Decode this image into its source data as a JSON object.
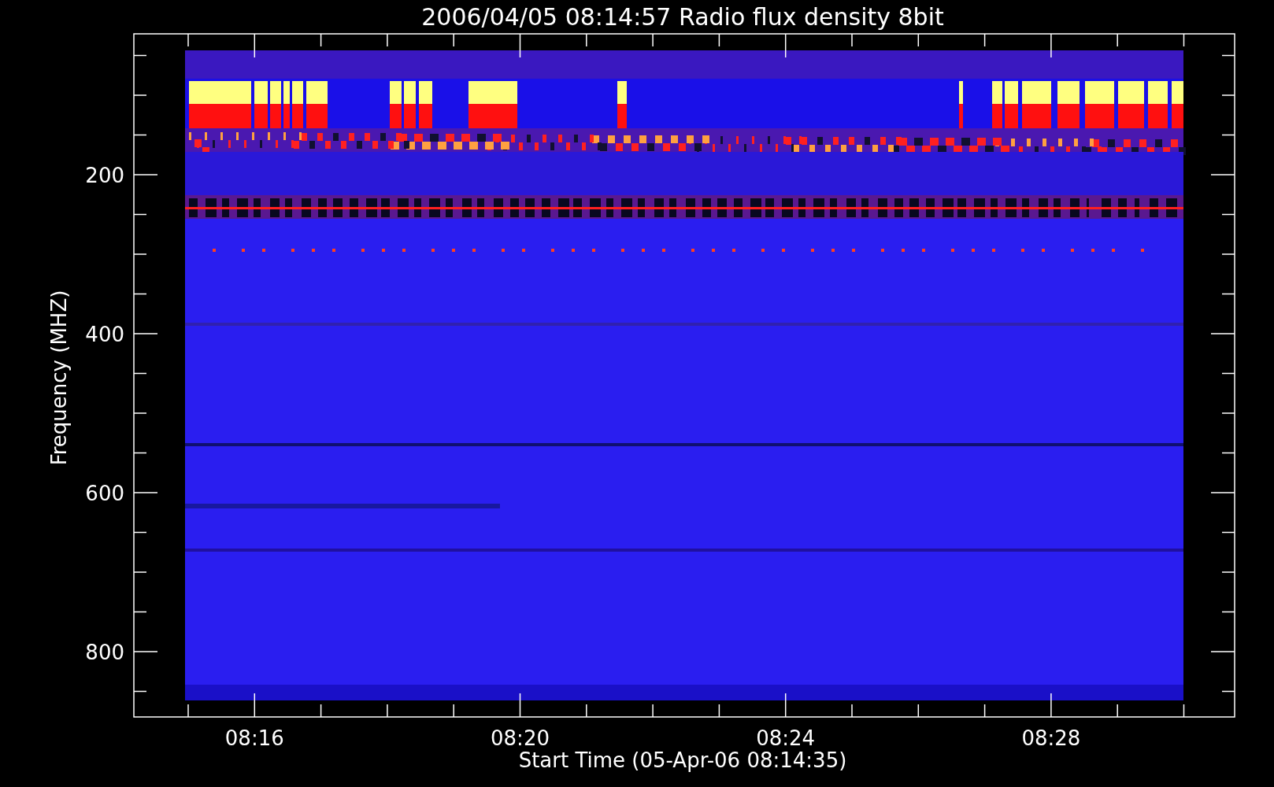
{
  "title": "2006/04/05 08:14:57 Radio flux density 8bit",
  "y_axis": {
    "label": "Frequency (MHZ)",
    "ticks": [
      "200",
      "400",
      "600",
      "800"
    ]
  },
  "x_axis": {
    "label": "Start Time (05-Apr-06 08:14:35)",
    "ticks": [
      "08:16",
      "08:20",
      "08:24",
      "08:28"
    ]
  }
}
